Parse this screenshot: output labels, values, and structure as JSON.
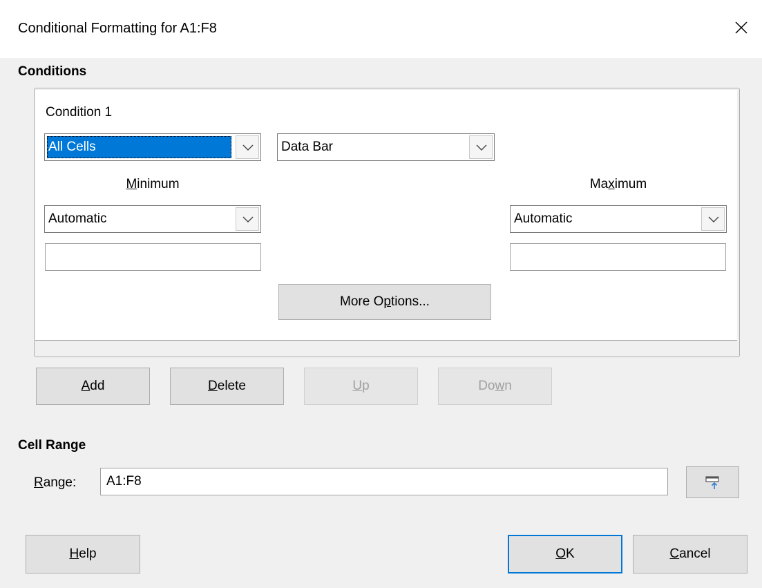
{
  "dialog": {
    "title": "Conditional Formatting for A1:F8",
    "close_icon": "close-icon"
  },
  "conditions": {
    "section_label": "Conditions",
    "condition_label": "Condition 1",
    "applies_to": "All Cells",
    "format_type": "Data Bar",
    "minimum": {
      "label_pre": "",
      "label_mnemonic": "M",
      "label_post": "inimum",
      "type": "Automatic",
      "value": ""
    },
    "maximum": {
      "label_pre": "Ma",
      "label_mnemonic": "x",
      "label_post": "imum",
      "type": "Automatic",
      "value": ""
    },
    "more_options": {
      "pre": "More O",
      "mnemonic": "p",
      "post": "tions..."
    }
  },
  "actions": {
    "add": {
      "mnemonic": "A",
      "post": "dd"
    },
    "delete": {
      "mnemonic": "D",
      "post": "elete"
    },
    "up": {
      "mnemonic": "U",
      "post": "p"
    },
    "down": {
      "pre": "Do",
      "mnemonic": "w",
      "post": "n"
    }
  },
  "cell_range": {
    "section_label": "Cell Range",
    "range_label_mnemonic": "R",
    "range_label_post": "ange:",
    "range_value": "A1:F8",
    "shrink_icon": "shrink-range-icon"
  },
  "footer": {
    "help": {
      "mnemonic": "H",
      "post": "elp"
    },
    "ok": {
      "mnemonic": "O",
      "post": "K"
    },
    "cancel": {
      "mnemonic": "C",
      "post": "ancel"
    }
  },
  "colors": {
    "accent": "#0078d7",
    "dialog_bg": "#f0f0f0",
    "button_bg": "#e1e1e1"
  }
}
